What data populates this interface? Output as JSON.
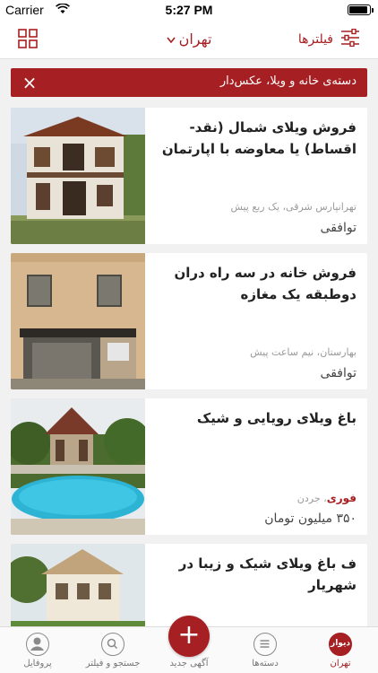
{
  "status_bar": {
    "carrier": "Carrier",
    "time": "5:27 PM"
  },
  "header": {
    "city": "تهران",
    "filters_label": "فیلترها"
  },
  "active_filter": {
    "label": "دسته‌ی خانه و ویلا، عکس‌دار"
  },
  "ads": [
    {
      "title": "فروش ویلای شمال (نقد-اقساط) یا معاوضه با اپارتمان",
      "meta": "تهرانپارس شرقی، یک ربع پیش",
      "price": "توافقی",
      "urgent": ""
    },
    {
      "title": "فروش خانه در سه راه دران دوطبقه یک مغازه",
      "meta": "بهارستان، نیم ساعت پیش",
      "price": "توافقی",
      "urgent": ""
    },
    {
      "title": "باغ ویلای رویایی و شیک",
      "meta": "، جردن",
      "price": "۳۵۰ میلیون تومان",
      "urgent": "فوری"
    },
    {
      "title": "ف باغ ویلای شیک و زیبا در شهریار",
      "meta": "",
      "price": "",
      "urgent": ""
    }
  ],
  "tabbar": {
    "profile": "پروفایل",
    "search": "جستجو و فیلتر",
    "new_ad": "آگهی جدید",
    "categories": "دسته‌ها",
    "home": "تهران",
    "home_logo": "دیوار"
  },
  "colors": {
    "accent": "#a61f22",
    "background": "#f1f1f1"
  }
}
